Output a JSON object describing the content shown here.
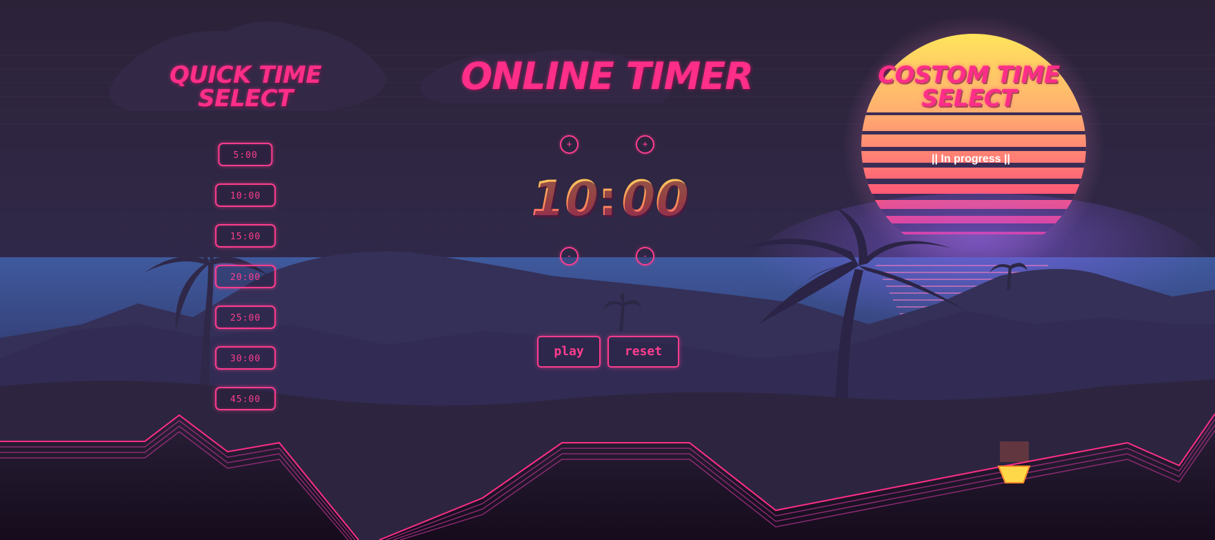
{
  "quick_panel": {
    "title": "QUICK TIME SELECT",
    "presets": [
      "5:00",
      "10:00",
      "15:00",
      "20:00",
      "25:00",
      "30:00",
      "45:00"
    ]
  },
  "timer": {
    "title": "ONLINE TIMER",
    "minutes": "10",
    "separator": ":",
    "seconds": "00",
    "plus_symbol": "+",
    "minus_symbol": "-",
    "play_label": "play",
    "reset_label": "reset"
  },
  "custom_panel": {
    "title": "COSTOM TIME SELECT",
    "status": "|| In progress ||"
  },
  "colors": {
    "accent": "#ff3d8e",
    "background": "#2e2540",
    "sun_top": "#ffe14d",
    "sun_bottom": "#ff2e7a",
    "sea": "#3b4c8a"
  }
}
